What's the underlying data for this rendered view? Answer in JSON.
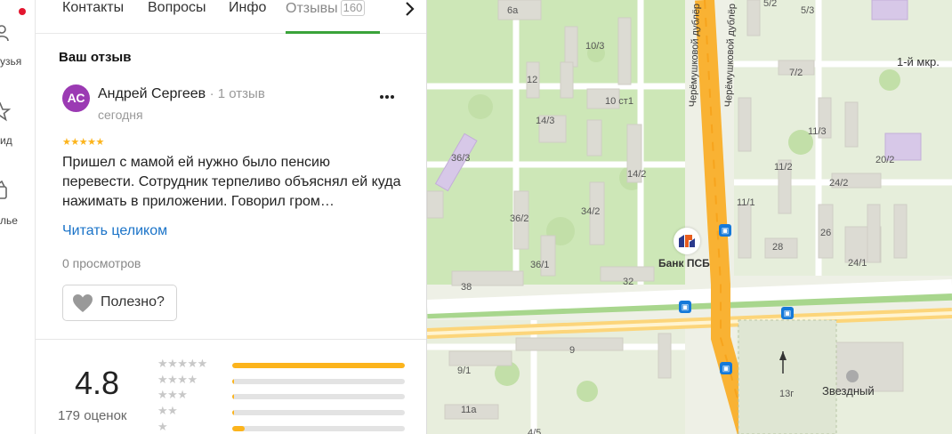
{
  "left_nav": {
    "items": [
      {
        "label": "узья",
        "icon": "friends-icon"
      },
      {
        "label": "ид",
        "icon": "star-icon"
      },
      {
        "label": "лье",
        "icon": "wallet-icon"
      }
    ]
  },
  "tabs": {
    "items": [
      {
        "label": "Контакты"
      },
      {
        "label": "Вопросы"
      },
      {
        "label": "Инфо"
      },
      {
        "label": "Отзывы",
        "count": "160"
      }
    ],
    "active": "Отзывы",
    "next_icon": "chevron-right-icon"
  },
  "review_section": {
    "title": "Ваш отзыв",
    "author": {
      "initials": "АС",
      "name": "Андрей Сергеев",
      "meta": "· 1 отзыв",
      "avatar_color": "#9b3ab3"
    },
    "date": "сегодня",
    "stars": "★★★★★",
    "rating": 5,
    "text": "Пришел с мамой ей нужно было пенсию перевести. Сотрудник терпеливо объяснял ей куда нажимать в приложении. Говорил гром…",
    "read_more": "Читать целиком",
    "views": "0 просмотров",
    "useful_label": "Полезно?"
  },
  "rating_summary": {
    "score": "4.8",
    "count": "179 оценок",
    "distribution": [
      {
        "stars": 5,
        "fraction": 1.0
      },
      {
        "stars": 4,
        "fraction": 0.01
      },
      {
        "stars": 3,
        "fraction": 0.01
      },
      {
        "stars": 2,
        "fraction": 0.01
      },
      {
        "stars": 1,
        "fraction": 0.07
      }
    ]
  },
  "map": {
    "building_labels": [
      "6а",
      "5/2",
      "5/3",
      "10/3",
      "12",
      "7/2",
      "1-й мкр.",
      "10 ст1",
      "14/3",
      "36/3",
      "11/3",
      "20/2",
      "14/2",
      "11/2",
      "24/2",
      "36/2",
      "34/2",
      "11/1",
      "26",
      "28",
      "24/1",
      "36/1",
      "32",
      "38",
      "9",
      "9/1",
      "11а",
      "13г",
      "4/5"
    ],
    "street_labels": [
      "Черёмушковой дублёр",
      "Черёмушковой дублёр"
    ],
    "poi": {
      "name": "Банк ПСБ"
    },
    "poi2": "Звездный",
    "colors": {
      "road_main": "#f9b233",
      "road_secondary": "#ffffff",
      "green": "#cde7b7",
      "building": "#dcdbd3",
      "poi_building": "#d7c8e8"
    }
  }
}
